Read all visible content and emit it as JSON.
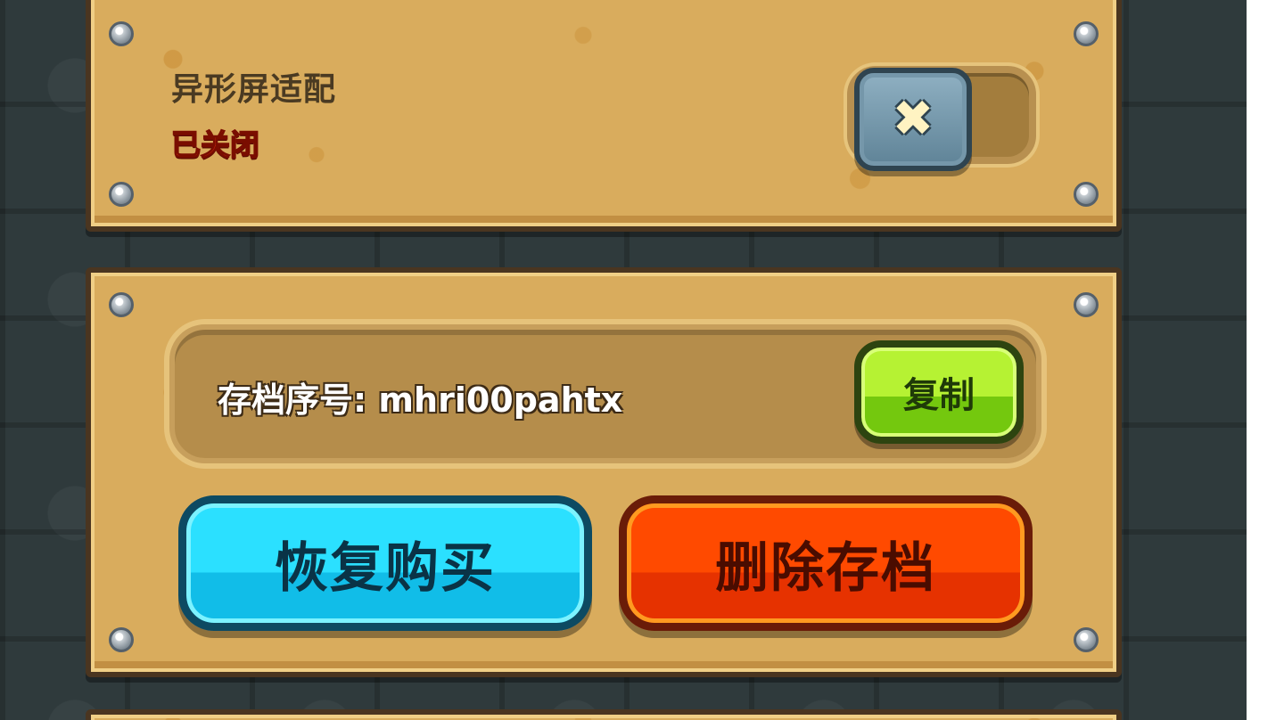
{
  "display_setting": {
    "title": "异形屏适配",
    "status": "已关闭",
    "toggle_state": "off",
    "toggle_icon": "x-icon"
  },
  "save_panel": {
    "save_id_text": "存档序号: mhri00pahtx",
    "copy_label": "复制",
    "restore_label": "恢复购买",
    "delete_label": "删除存档"
  },
  "colors": {
    "panel": "#d9ac5d",
    "status_red": "#ff3a1a",
    "copy_green": "#b6f233",
    "restore_cyan": "#2be0ff",
    "delete_orange": "#ff4a00"
  }
}
